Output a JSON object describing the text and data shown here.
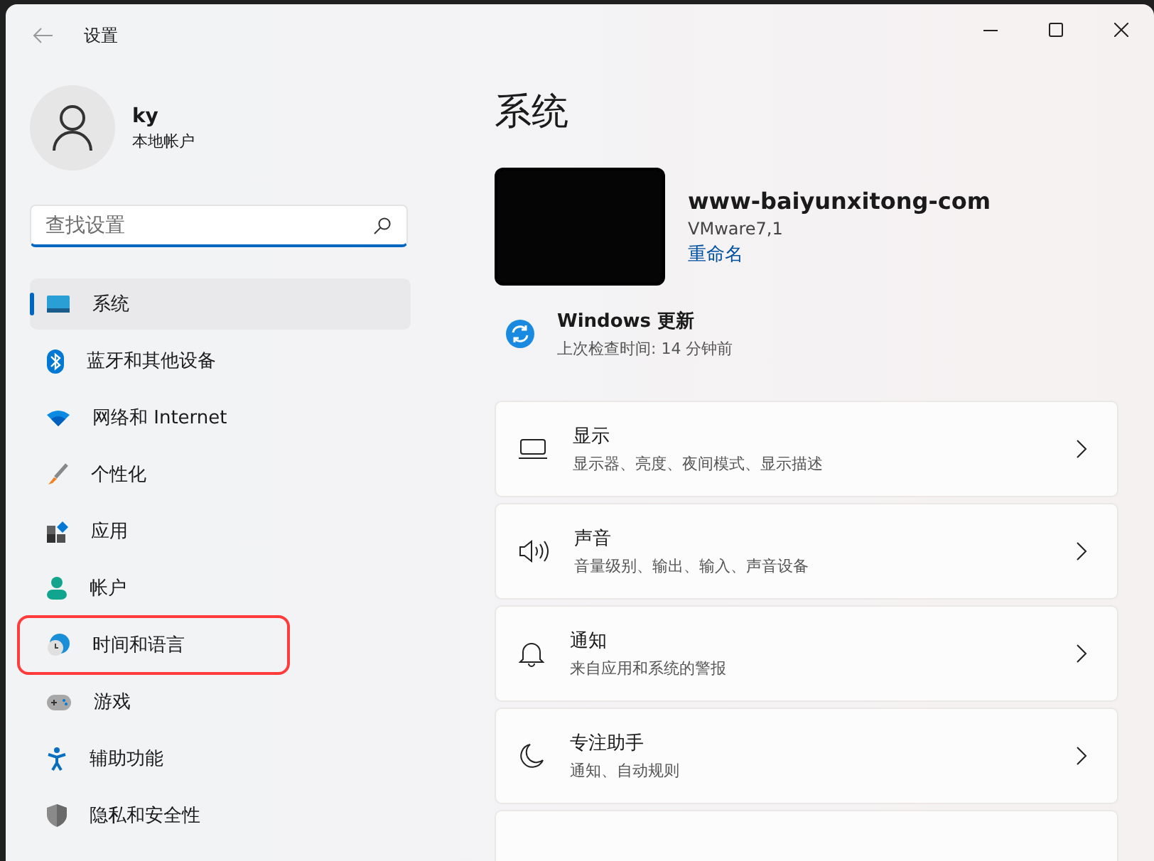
{
  "window": {
    "title": "设置"
  },
  "account": {
    "name": "ky",
    "type": "本地帐户"
  },
  "search": {
    "placeholder": "查找设置"
  },
  "nav": [
    {
      "label": "系统",
      "selected": true,
      "highlighted": false
    },
    {
      "label": "蓝牙和其他设备",
      "selected": false,
      "highlighted": false
    },
    {
      "label": "网络和 Internet",
      "selected": false,
      "highlighted": false
    },
    {
      "label": "个性化",
      "selected": false,
      "highlighted": false
    },
    {
      "label": "应用",
      "selected": false,
      "highlighted": false
    },
    {
      "label": "帐户",
      "selected": false,
      "highlighted": false
    },
    {
      "label": "时间和语言",
      "selected": false,
      "highlighted": true
    },
    {
      "label": "游戏",
      "selected": false,
      "highlighted": false
    },
    {
      "label": "辅助功能",
      "selected": false,
      "highlighted": false
    },
    {
      "label": "隐私和安全性",
      "selected": false,
      "highlighted": false
    }
  ],
  "page_title": "系统",
  "device": {
    "name": "www-baiyunxitong-com",
    "model": "VMware7,1",
    "rename": "重命名"
  },
  "update": {
    "title": "Windows 更新",
    "status": "上次检查时间: 14 分钟前"
  },
  "cards": [
    {
      "title": "显示",
      "subtitle": "显示器、亮度、夜间模式、显示描述"
    },
    {
      "title": "声音",
      "subtitle": "音量级别、输出、输入、声音设备"
    },
    {
      "title": "通知",
      "subtitle": "来自应用和系统的警报"
    },
    {
      "title": "专注助手",
      "subtitle": "通知、自动规则"
    }
  ]
}
